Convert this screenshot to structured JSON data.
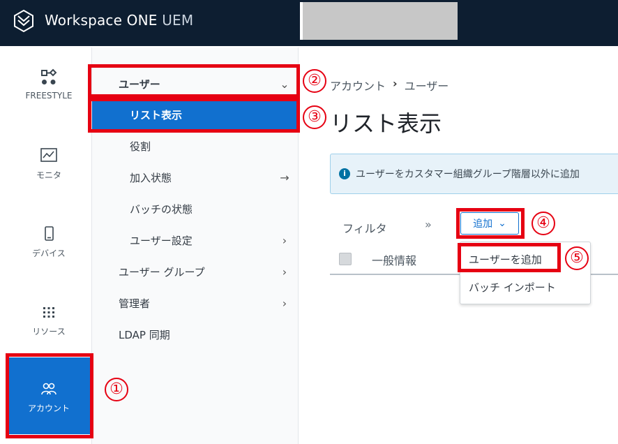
{
  "topbar": {
    "app_name": "Workspace ONE",
    "app_suffix": "UEM"
  },
  "rail": {
    "items": [
      {
        "label": "FREESTYLE",
        "icon": "freestyle-icon"
      },
      {
        "label": "モニタ",
        "icon": "monitor-chart-icon"
      },
      {
        "label": "デバイス",
        "icon": "phone-icon"
      },
      {
        "label": "リソース",
        "icon": "grid-dots-icon"
      },
      {
        "label": "アカウント",
        "icon": "users-icon",
        "active": true
      }
    ]
  },
  "subnav": {
    "items": [
      {
        "label": "ユーザー",
        "chevron": "⌄"
      },
      {
        "label": "リスト表示",
        "selected": true
      },
      {
        "label": "役割"
      },
      {
        "label": "加入状態",
        "chevron": "→"
      },
      {
        "label": "バッチの状態"
      },
      {
        "label": "ユーザー設定",
        "chevron": "›"
      },
      {
        "label": "ユーザー グループ",
        "chevron": "›"
      },
      {
        "label": "管理者",
        "chevron": "›"
      },
      {
        "label": "LDAP 同期"
      }
    ]
  },
  "main": {
    "breadcrumb": [
      "アカウント",
      "›",
      "ユーザー"
    ],
    "title": "リスト表示",
    "info": "ユーザーをカスタマー組織グループ階層以外に追加",
    "filter_label": "フィルタ",
    "more_chevron": "»",
    "add_button": "追加",
    "add_chevron": "⌄",
    "column_general": "一般情報",
    "dropdown": [
      "ユーザーを追加",
      "バッチ インポート"
    ]
  },
  "annotations": [
    "①",
    "②",
    "③",
    "④",
    "⑤"
  ],
  "colors": {
    "accent": "#1170cf",
    "topbar": "#0d1e31",
    "annotation": "#e60012"
  }
}
